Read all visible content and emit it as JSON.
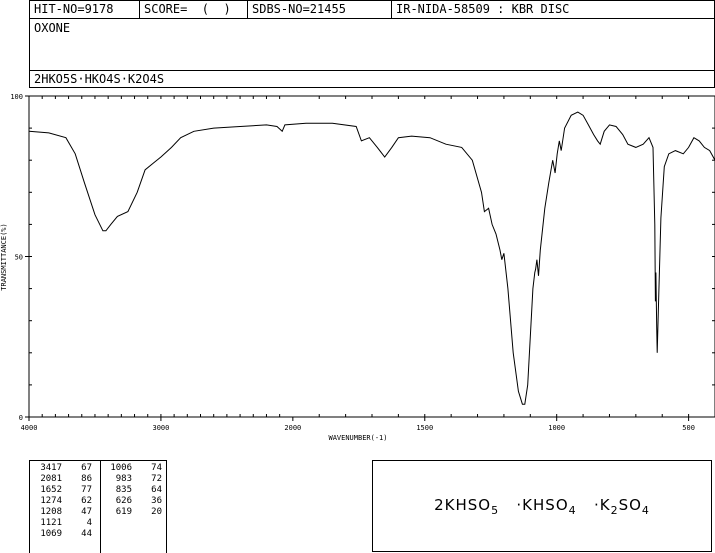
{
  "header": {
    "hit_no": "HIT-NO=9178",
    "score": "SCORE=  (  )",
    "sdbs_no": "SDBS-NO=21455",
    "ir_info": "IR-NIDA-58509 : KBR DISC"
  },
  "compound_name": "OXONE",
  "formula_line": "2HKO5S·HKO4S·K2O4S",
  "formula_display": "2KHSO5  ·KHSO4  ·K2SO4",
  "chart_data": {
    "type": "line",
    "title": "",
    "xlabel": "WAVENUMBER(-1)",
    "ylabel": "TRANSMITTANCE(%)",
    "xlim": [
      4000,
      400
    ],
    "ylim": [
      0,
      100
    ],
    "x_ticks": [
      4000,
      3000,
      2000,
      1500,
      1000,
      500
    ],
    "y_ticks": [
      0,
      50,
      100
    ],
    "grid": false,
    "series": [
      {
        "points": [
          [
            4000,
            89
          ],
          [
            3850,
            88.5
          ],
          [
            3720,
            87
          ],
          [
            3650,
            82
          ],
          [
            3580,
            73
          ],
          [
            3500,
            63
          ],
          [
            3440,
            58
          ],
          [
            3417,
            58
          ],
          [
            3380,
            60
          ],
          [
            3330,
            62.5
          ],
          [
            3250,
            64
          ],
          [
            3180,
            70
          ],
          [
            3120,
            77
          ],
          [
            3060,
            79
          ],
          [
            3000,
            81
          ],
          [
            2920,
            84
          ],
          [
            2850,
            87
          ],
          [
            2750,
            89
          ],
          [
            2600,
            90
          ],
          [
            2400,
            90.5
          ],
          [
            2200,
            91
          ],
          [
            2120,
            90.5
          ],
          [
            2081,
            89
          ],
          [
            2060,
            91
          ],
          [
            1950,
            91.5
          ],
          [
            1850,
            91.5
          ],
          [
            1760,
            90.5
          ],
          [
            1740,
            86
          ],
          [
            1710,
            87
          ],
          [
            1680,
            84
          ],
          [
            1652,
            81
          ],
          [
            1625,
            84
          ],
          [
            1600,
            87
          ],
          [
            1550,
            87.5
          ],
          [
            1480,
            87
          ],
          [
            1420,
            85
          ],
          [
            1360,
            84
          ],
          [
            1320,
            80
          ],
          [
            1285,
            70
          ],
          [
            1274,
            64
          ],
          [
            1258,
            65
          ],
          [
            1245,
            60
          ],
          [
            1230,
            57
          ],
          [
            1215,
            52
          ],
          [
            1208,
            49
          ],
          [
            1200,
            51
          ],
          [
            1185,
            40
          ],
          [
            1165,
            20
          ],
          [
            1145,
            8
          ],
          [
            1130,
            4
          ],
          [
            1121,
            4
          ],
          [
            1110,
            10
          ],
          [
            1100,
            25
          ],
          [
            1090,
            40
          ],
          [
            1083,
            45
          ],
          [
            1080,
            46
          ],
          [
            1075,
            49
          ],
          [
            1069,
            44
          ],
          [
            1062,
            52
          ],
          [
            1045,
            65
          ],
          [
            1030,
            73
          ],
          [
            1015,
            80
          ],
          [
            1006,
            76
          ],
          [
            998,
            82
          ],
          [
            990,
            86
          ],
          [
            983,
            83
          ],
          [
            970,
            90
          ],
          [
            945,
            94
          ],
          [
            920,
            95
          ],
          [
            900,
            94
          ],
          [
            880,
            91
          ],
          [
            860,
            88
          ],
          [
            845,
            86
          ],
          [
            835,
            85
          ],
          [
            820,
            89
          ],
          [
            800,
            91
          ],
          [
            775,
            90.5
          ],
          [
            750,
            88
          ],
          [
            730,
            85
          ],
          [
            700,
            84
          ],
          [
            672,
            85
          ],
          [
            650,
            87
          ],
          [
            635,
            84
          ],
          [
            628,
            60
          ],
          [
            626,
            36
          ],
          [
            624,
            45
          ],
          [
            621,
            28
          ],
          [
            619,
            20
          ],
          [
            614,
            35
          ],
          [
            605,
            62
          ],
          [
            592,
            78
          ],
          [
            575,
            82
          ],
          [
            550,
            83
          ],
          [
            520,
            82
          ],
          [
            500,
            84
          ],
          [
            480,
            87
          ],
          [
            460,
            86
          ],
          [
            440,
            84
          ],
          [
            420,
            83
          ],
          [
            400,
            80
          ]
        ]
      }
    ]
  },
  "peak_table": {
    "columns": [
      [
        [
          "3417",
          "67"
        ],
        [
          "2081",
          "86"
        ],
        [
          "1652",
          "77"
        ],
        [
          "1274",
          "62"
        ],
        [
          "1208",
          "47"
        ],
        [
          "1121",
          "4"
        ],
        [
          "1069",
          "44"
        ]
      ],
      [
        [
          "1006",
          "74"
        ],
        [
          "983",
          "72"
        ],
        [
          "835",
          "64"
        ],
        [
          "626",
          "36"
        ],
        [
          "619",
          "20"
        ]
      ]
    ]
  }
}
